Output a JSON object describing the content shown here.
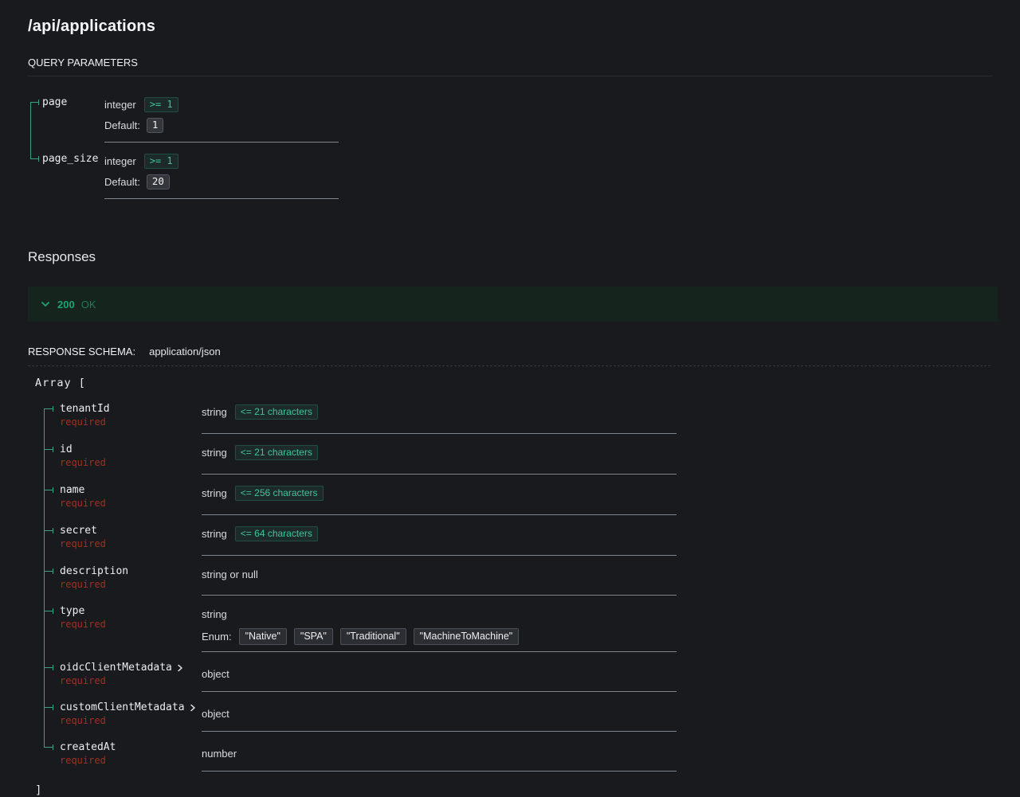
{
  "page": {
    "title": "/api/applications"
  },
  "labels": {
    "query_parameters": "QUERY PARAMETERS",
    "default": "Default:",
    "responses": "Responses",
    "response_schema": "RESPONSE SCHEMA:",
    "content_type": "application/json",
    "array_open": "Array [",
    "array_close": "]",
    "required": "required",
    "enum": "Enum:"
  },
  "status": {
    "code": "200",
    "text": "OK"
  },
  "icons": {
    "response_toggle": "chevron-down-icon",
    "field_expand": "chevron-right-icon"
  },
  "query_params": [
    {
      "name": "page",
      "type": "integer",
      "constraint": ">= 1",
      "default": "1"
    },
    {
      "name": "page_size",
      "type": "integer",
      "constraint": ">= 1",
      "default": "20"
    }
  ],
  "schema_fields": [
    {
      "name": "tenantId",
      "type": "string",
      "constraint": "<= 21 characters",
      "required": true
    },
    {
      "name": "id",
      "type": "string",
      "constraint": "<= 21 characters",
      "required": true
    },
    {
      "name": "name",
      "type": "string",
      "constraint": "<= 256 characters",
      "required": true
    },
    {
      "name": "secret",
      "type": "string",
      "constraint": "<= 64 characters",
      "required": true
    },
    {
      "name": "description",
      "type": "string or null",
      "required": true
    },
    {
      "name": "type",
      "type": "string",
      "required": true,
      "enum": [
        "\"Native\"",
        "\"SPA\"",
        "\"Traditional\"",
        "\"MachineToMachine\""
      ]
    },
    {
      "name": "oidcClientMetadata",
      "type": "object",
      "required": true,
      "expandable": true
    },
    {
      "name": "customClientMetadata",
      "type": "object",
      "required": true,
      "expandable": true
    },
    {
      "name": "createdAt",
      "type": "number",
      "required": true
    }
  ],
  "colors": {
    "background": "#191a1d",
    "accent_teal": "#3fc39d",
    "tree_line": "#3aa08a",
    "required_red": "#a52e20",
    "status_green": "#1fa373",
    "response_bar_bg": "#16241e",
    "divider_gray": "#7e848c"
  }
}
